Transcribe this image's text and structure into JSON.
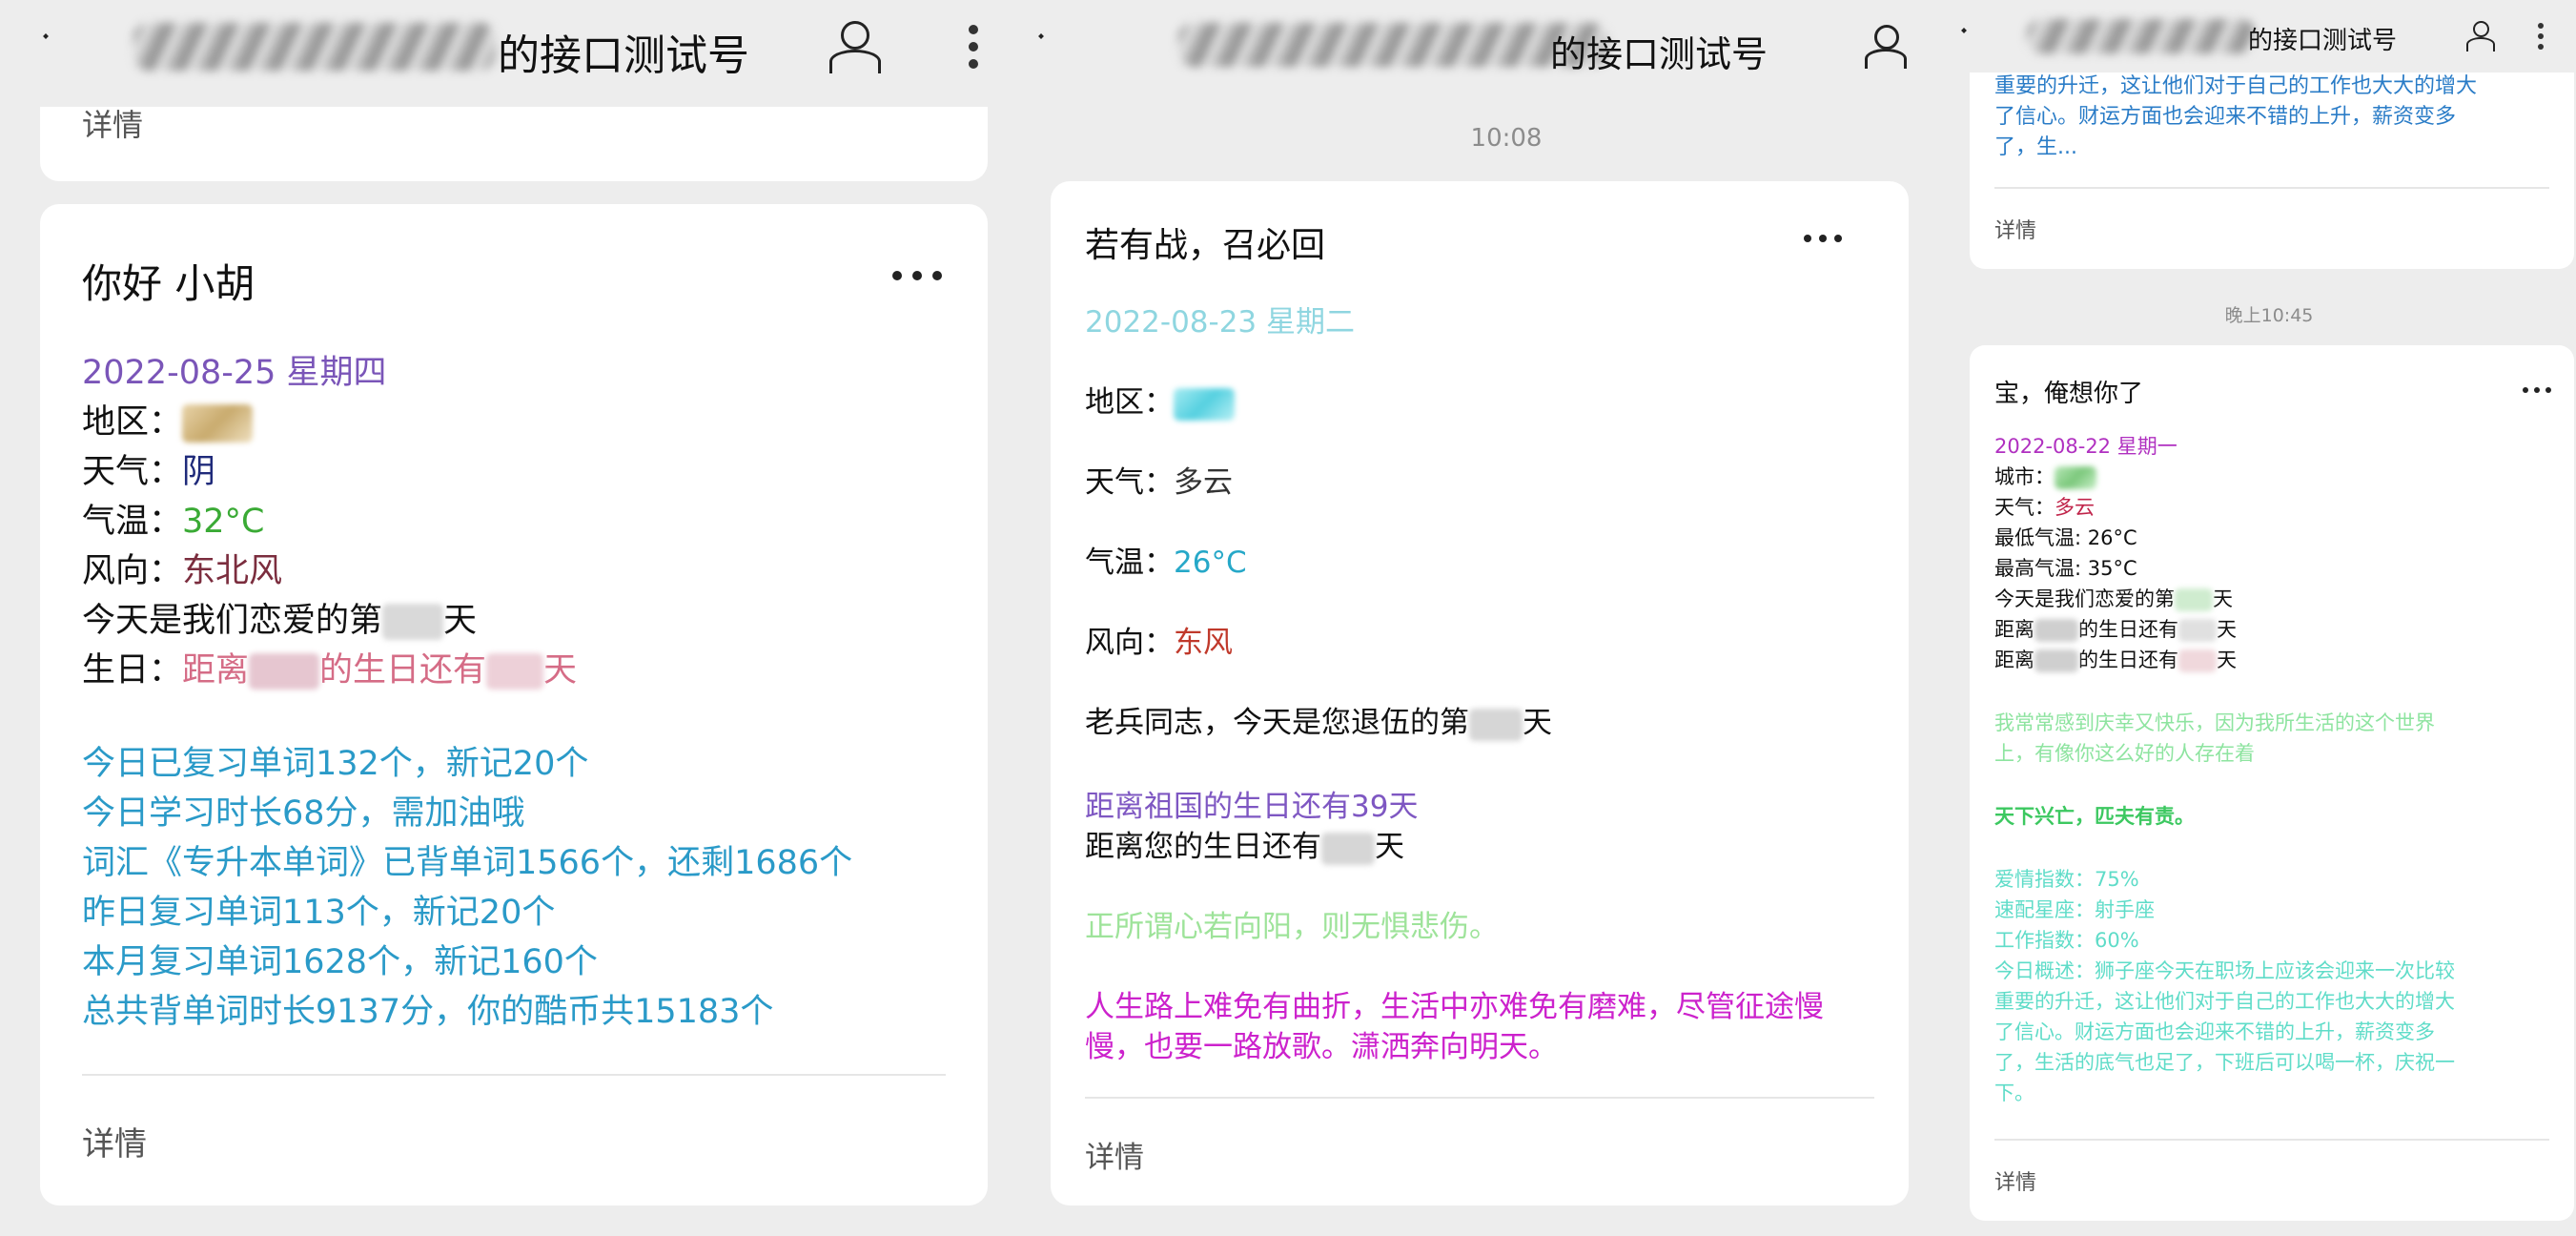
{
  "panel1": {
    "header": {
      "title": "的接口测试号"
    },
    "prev_card": {
      "detail": "详情"
    },
    "card": {
      "title": "你好 小胡",
      "date": "2022-08-25 星期四",
      "region_label": "地区：",
      "weather_label": "天气：",
      "weather_value": "阴",
      "temp_label": "气温：",
      "temp_value": "32°C",
      "wind_label": "风向：",
      "wind_value": "东北风",
      "love_prefix": "今天是我们恋爱的第",
      "love_suffix": "天",
      "birthday_label": "生日：",
      "birthday_a": "距离",
      "birthday_b": "的生日还有",
      "birthday_c": "天",
      "study": [
        "今日已复习单词132个，新记20个",
        "今日学习时长68分，需加油哦",
        "词汇《专升本单词》已背单词1566个，还剩1686个",
        "昨日复习单词113个，新记20个",
        "本月复习单词1628个，新记160个",
        "总共背单词时长9137分，你的酷币共15183个"
      ],
      "detail": "详情"
    },
    "colors": {
      "date": "#7a55b8",
      "blue": "#2a9ac8",
      "green": "#3aaa35",
      "wind": "#7b2d3e",
      "pink": "#d56c86",
      "navy": "#1f2a7a"
    }
  },
  "panel2": {
    "header": {
      "title": "的接口测试号"
    },
    "time": "10:08",
    "card": {
      "title": "若有战，召必回",
      "date": "2022-08-23 星期二",
      "region_label": "地区：",
      "weather_label": "天气：",
      "weather_value": "多云",
      "temp_label": "气温：",
      "temp_value": "26°C",
      "wind_label": "风向：",
      "wind_value": "东风",
      "veteran_prefix": "老兵同志，今天是您退伍的第",
      "veteran_suffix": "天",
      "country_birthday": "距离祖国的生日还有39天",
      "your_birthday_prefix": "距离您的生日还有",
      "your_birthday_suffix": "天",
      "quote1": "正所谓心若向阳，则无惧悲伤。",
      "quote2_line1": "人生路上难免有曲折，生活中亦难免有磨难，尽管征途慢",
      "quote2_line2": "慢，也要一路放歌。潇洒奔向明天。",
      "detail": "详情"
    },
    "colors": {
      "date": "#8fd6e0",
      "temp": "#26a8c8",
      "wind": "#c0392b",
      "purple": "#7e57c2",
      "green": "#9ee39a",
      "magenta": "#cc22cc"
    }
  },
  "panel3": {
    "header": {
      "title": "的接口测试号"
    },
    "prev_card": {
      "lines": [
        "重要的升迁，这让他们对于自己的工作也大大的增大",
        "了信心。财运方面也会迎来不错的上升，薪资变多",
        "了，生..."
      ],
      "detail": "详情"
    },
    "time": "晚上10:45",
    "card": {
      "title": "宝，俺想你了",
      "date": "2022-08-22 星期一",
      "city_label": "城市：",
      "weather_label": "天气：",
      "weather_value": "多云",
      "min_temp": "最低气温: 26°C",
      "max_temp": "最高气温: 35°C",
      "love_prefix": "今天是我们恋爱的第",
      "love_suffix": "天",
      "bday_a": "距离",
      "bday_b": "的生日还有",
      "bday_c": "天",
      "quote1_line1": "我常常感到庆幸又快乐，因为我所生活的这个世界",
      "quote1_line2": "上，有像你这么好的人存在着",
      "quote2": "天下兴亡，匹夫有责。",
      "love_index": "爱情指数：75%",
      "match_sign": "速配星座：射手座",
      "work_index": "工作指数：60%",
      "overview": [
        "今日概述：狮子座今天在职场上应该会迎来一次比较",
        "重要的升迁，这让他们对于自己的工作也大大的增大",
        "了信心。财运方面也会迎来不错的上升，薪资变多",
        "了，生活的底气也足了，下班后可以喝一杯，庆祝一",
        "下。"
      ],
      "detail": "详情"
    },
    "colors": {
      "date": "#b030c0",
      "weather": "#c0244a",
      "blue": "#2a7cc7",
      "green": "#8ee4a0",
      "green_bold": "#3cc860",
      "teal": "#5fdcc8"
    }
  }
}
